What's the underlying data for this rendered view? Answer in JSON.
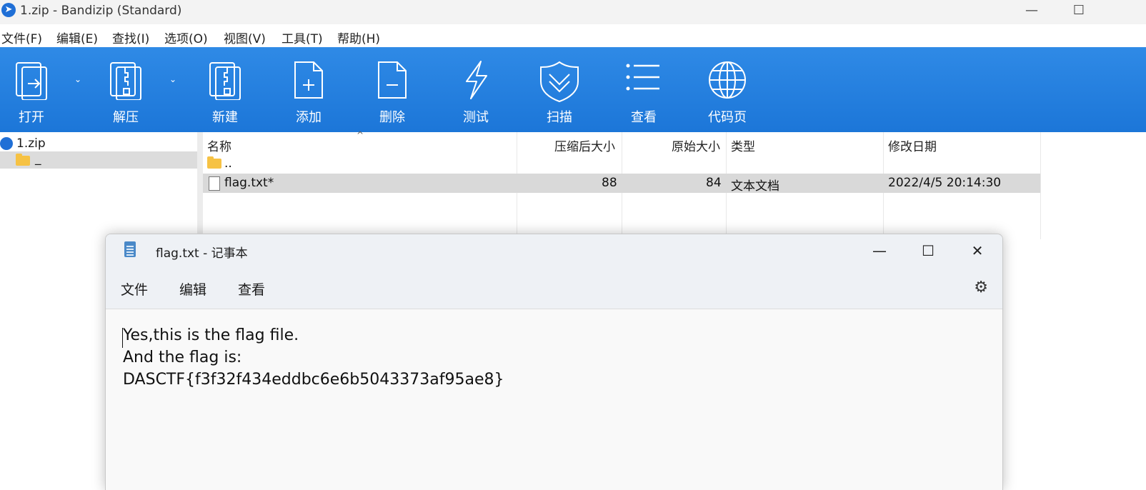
{
  "app": {
    "title": "1.zip - Bandizip (Standard)",
    "minimize": "—",
    "maximize": "☐"
  },
  "menubar": [
    "文件(F)",
    "编辑(E)",
    "查找(I)",
    "选项(O)",
    "视图(V)",
    "工具(T)",
    "帮助(H)"
  ],
  "toolbar": {
    "open": "打开",
    "extract": "解压",
    "new": "新建",
    "add": "添加",
    "delete": "删除",
    "test": "测试",
    "scan": "扫描",
    "view": "查看",
    "codepage": "代码页"
  },
  "tree": {
    "root": "1.zip",
    "child": "_"
  },
  "columns": {
    "name": "名称",
    "packed": "压缩后大小",
    "size": "原始大小",
    "type": "类型",
    "modified": "修改日期"
  },
  "rows": [
    {
      "name": "..",
      "packed": "",
      "size": "",
      "type": "",
      "modified": ""
    },
    {
      "name": "flag.txt*",
      "packed": "88",
      "size": "84",
      "type": "文本文档",
      "modified": "2022/4/5 20:14:30"
    }
  ],
  "notepad": {
    "title": "flag.txt - 记事本",
    "menu": [
      "文件",
      "编辑",
      "查看"
    ],
    "lines": [
      "Yes,this is the flag file.",
      "And the flag is:",
      "DASCTF{f3f32f434eddbc6e6b5043373af95ae8}"
    ]
  },
  "colors": {
    "toolbar_blue": "#1f7ddb",
    "selection_gray": "#d9d9d9"
  }
}
